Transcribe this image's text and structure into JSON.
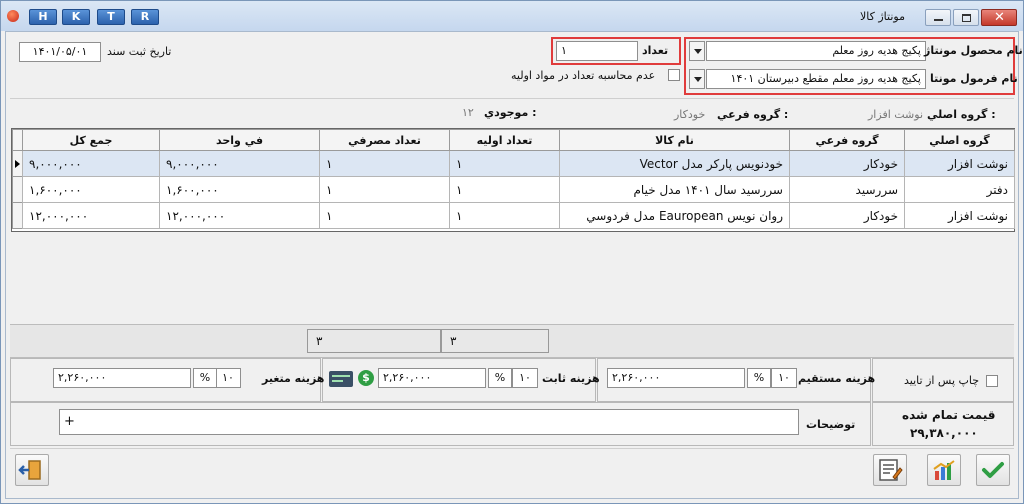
{
  "title": "مونتاژ کالا",
  "quick_buttons": [
    "H",
    "K",
    "T",
    "R"
  ],
  "header": {
    "doc_date_label": "تاريخ ثبت سند",
    "doc_date": "۱۴۰۱/۰۵/۰۱",
    "quantity_label": "تعداد",
    "quantity_value": "۱",
    "product_label": "نام محصول مونتاژ",
    "product_value": "پکيج هديه روز معلم",
    "formula_label": "نام فرمول مونتا",
    "formula_value": "پکيج هديه روز معلم مقطع دبيرستان ۱۴۰۱",
    "no_calc_label": "عدم محاسبه تعداد در مواد اوليه"
  },
  "info": {
    "main_group_label": "گروه اصلي :",
    "main_group_value": "نوشت افزار",
    "sub_group_label": "گروه فرعي :",
    "sub_group_value": "خودکار",
    "stock_label": "موجودي :",
    "stock_value": "۱۲"
  },
  "table": {
    "columns": [
      "گروه اصلي",
      "گروه فرعي",
      "نام کالا",
      "تعداد اوليه",
      "تعداد مصرفي",
      "في واحد",
      "جمع کل"
    ],
    "rows": [
      [
        "نوشت افزار",
        "خودکار",
        "خودنويس پارکر مدل Vector",
        "۱",
        "۱",
        "۹,۰۰۰,۰۰۰",
        "۹,۰۰۰,۰۰۰"
      ],
      [
        "دفتر",
        "سررسيد",
        "سررسيد سال ۱۴۰۱ مدل خيام",
        "۱",
        "۱",
        "۱,۶۰۰,۰۰۰",
        "۱,۶۰۰,۰۰۰"
      ],
      [
        "نوشت افزار",
        "خودکار",
        "روان نويس Eauropean مدل فردوسي",
        "۱",
        "۱",
        "۱۲,۰۰۰,۰۰۰",
        "۱۲,۰۰۰,۰۰۰"
      ]
    ]
  },
  "footer_totals": {
    "initial_qty_total": "۳",
    "used_qty_total": "۳"
  },
  "costs": {
    "print_after_confirm_label": "چاپ پس از تاييد",
    "direct_label": "هزينه مستقيم",
    "direct_pct": "۱۰",
    "direct_amount": "۲,۲۶۰,۰۰۰",
    "fixed_label": "هزينه ثابت",
    "fixed_pct": "۱۰",
    "fixed_amount": "۲,۲۶۰,۰۰۰",
    "variable_label": "هزينه متغير",
    "variable_pct": "۱۰",
    "variable_amount": "۲,۲۶۰,۰۰۰",
    "percent_sign": "%"
  },
  "finished_price_label": "قيمت تمام شده",
  "finished_price": "۲۹,۳۸۰,۰۰۰",
  "notes_label": "توضيحات",
  "notes_value": "+",
  "icons": [
    "exit-icon",
    "notes-edit-icon",
    "chart-icon",
    "checkmark-icon",
    "money-card-icon",
    "dollar-coin-icon"
  ],
  "colors": {
    "highlight_border": "#e03c3c",
    "selected_row": "#dce6f3",
    "confirm_green": "#2f9e44"
  }
}
